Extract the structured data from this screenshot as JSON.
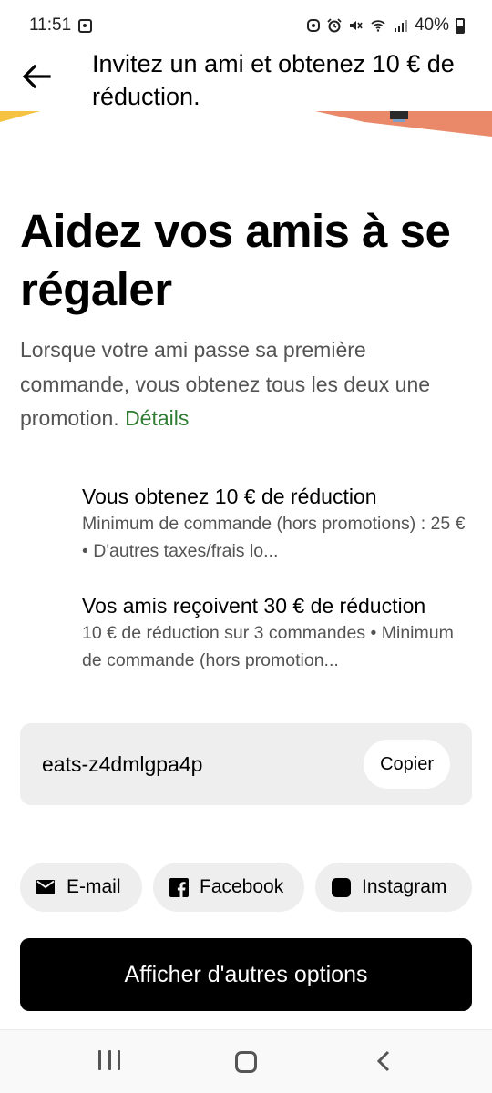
{
  "status_bar": {
    "time": "11:51",
    "battery": "40%"
  },
  "header": {
    "title": "Invitez un ami et obtenez 10 € de réduction."
  },
  "hero": {
    "title": "Aidez vos amis à se régaler",
    "description": "Lorsque votre ami passe sa première commande, vous obtenez tous les deux une promotion.",
    "details_link": "Détails"
  },
  "rewards": [
    {
      "title": "Vous obtenez 10 € de réduction",
      "text": "Minimum de commande (hors promotions) : 25 € • D'autres taxes/frais lo..."
    },
    {
      "title": "Vos amis reçoivent 30 € de réduction",
      "text": "10 € de réduction sur 3 commandes • Minimum de commande (hors promotion..."
    }
  ],
  "referral": {
    "code": "eats-z4dmlgpa4p",
    "copy_label": "Copier"
  },
  "share": {
    "email": "E-mail",
    "facebook": "Facebook",
    "instagram": "Instagram"
  },
  "more_options_label": "Afficher d'autres options",
  "colors": {
    "link_green": "#2e7d32",
    "banner_yellow": "#f5c242",
    "banner_orange": "#e9896a",
    "primary_button": "#000000"
  },
  "icons": [
    "back-arrow-icon",
    "mail-icon",
    "facebook-icon",
    "instagram-icon",
    "nav-recents-icon",
    "nav-home-icon",
    "nav-back-icon"
  ]
}
